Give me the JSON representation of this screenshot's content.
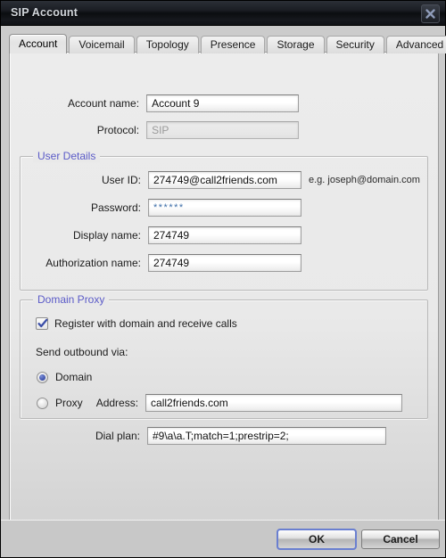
{
  "window": {
    "title": "SIP Account",
    "close_icon": "close-icon"
  },
  "tabs": [
    {
      "label": "Account",
      "selected": true
    },
    {
      "label": "Voicemail",
      "selected": false
    },
    {
      "label": "Topology",
      "selected": false
    },
    {
      "label": "Presence",
      "selected": false
    },
    {
      "label": "Storage",
      "selected": false
    },
    {
      "label": "Security",
      "selected": false
    },
    {
      "label": "Advanced",
      "selected": false
    }
  ],
  "account": {
    "account_name_label": "Account name:",
    "account_name_value": "Account 9",
    "protocol_label": "Protocol:",
    "protocol_value": "SIP"
  },
  "user_details": {
    "legend": "User Details",
    "user_id_label": "User ID:",
    "user_id_value": "274749@call2friends.com",
    "user_id_hint": "e.g. joseph@domain.com",
    "password_label": "Password:",
    "password_value": "******",
    "display_name_label": "Display name:",
    "display_name_value": "274749",
    "authorization_name_label": "Authorization name:",
    "authorization_name_value": "274749"
  },
  "domain_proxy": {
    "legend": "Domain Proxy",
    "register_label": "Register with domain and receive calls",
    "register_checked": true,
    "send_outbound_label": "Send outbound via:",
    "domain_radio_label": "Domain",
    "domain_radio_selected": true,
    "proxy_radio_label": "Proxy",
    "proxy_radio_selected": false,
    "address_label": "Address:",
    "address_value": "call2friends.com"
  },
  "dial_plan": {
    "label": "Dial plan:",
    "value": "#9\\a\\a.T;match=1;prestrip=2;"
  },
  "buttons": {
    "ok": "OK",
    "cancel": "Cancel"
  },
  "colors": {
    "legend_blue": "#5b5bc8",
    "accent_focus": "#6a7fd0",
    "titlebar": "#14171c"
  }
}
